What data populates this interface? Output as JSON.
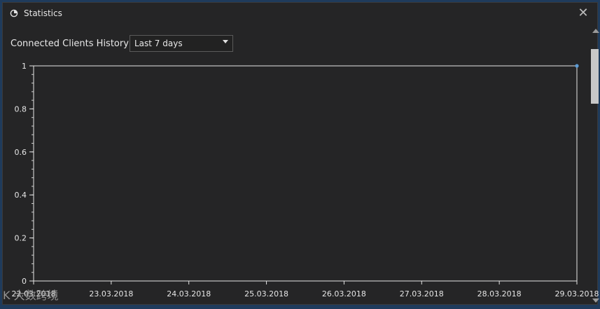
{
  "window": {
    "title": "Statistics",
    "close_glyph": "✕"
  },
  "header": {
    "label": "Connected Clients History",
    "range_select": {
      "value": "Last 7 days",
      "options": [
        "Last 7 days"
      ]
    }
  },
  "watermark": {
    "text": "K 大数跨境"
  },
  "colors": {
    "accent": "#2f7de1",
    "point": "#5b9bd5",
    "background": "#252526"
  },
  "chart_data": {
    "type": "scatter",
    "title": "",
    "xlabel": "",
    "ylabel": "",
    "x_tick_labels": [
      "22.03.2018",
      "23.03.2018",
      "24.03.2018",
      "25.03.2018",
      "26.03.2018",
      "27.03.2018",
      "28.03.2018",
      "29.03.2018"
    ],
    "y_tick_labels": [
      "0",
      "0.2",
      "0.4",
      "0.6",
      "0.8",
      "1"
    ],
    "ylim": [
      0,
      1
    ],
    "grid": false,
    "series": [
      {
        "x": [
          "29.03.2018"
        ],
        "values": [
          1
        ]
      }
    ]
  }
}
